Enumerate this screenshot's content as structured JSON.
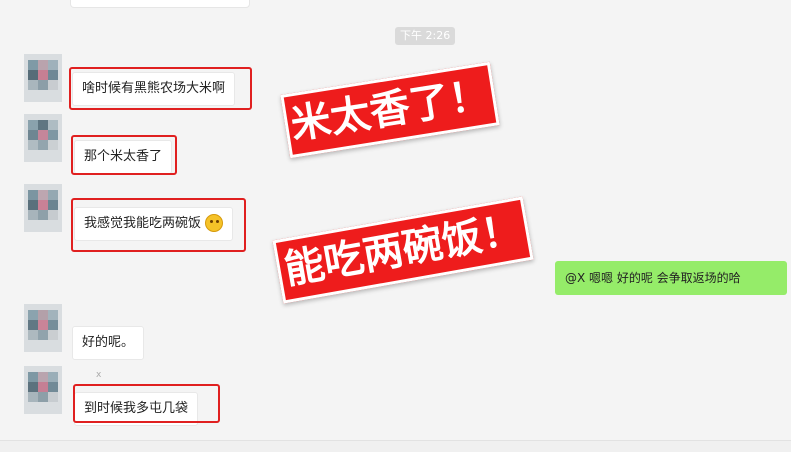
{
  "chat": {
    "timestamp": "下午 2:26",
    "messages": [
      {
        "text": "啥时候有黑熊农场大米啊"
      },
      {
        "text": "那个米太香了"
      },
      {
        "text": "我感觉我能吃两碗饭",
        "emoji": "thinking-face-emoji"
      },
      {
        "text": "好的呢。"
      },
      {
        "text": "到时候我多屯几袋"
      }
    ],
    "outgoing": {
      "text": "@X 嗯嗯 好的呢   会争取返场的哈"
    },
    "name_tick": "x",
    "annotations": {
      "stamp_top": "米太香了！",
      "stamp_bottom": "能吃两碗饭！"
    }
  },
  "colors": {
    "highlight": "#e02020",
    "stamp": "#ee1c1c",
    "outgoing_bubble": "#95ec69",
    "background": "#f4f4f4"
  }
}
